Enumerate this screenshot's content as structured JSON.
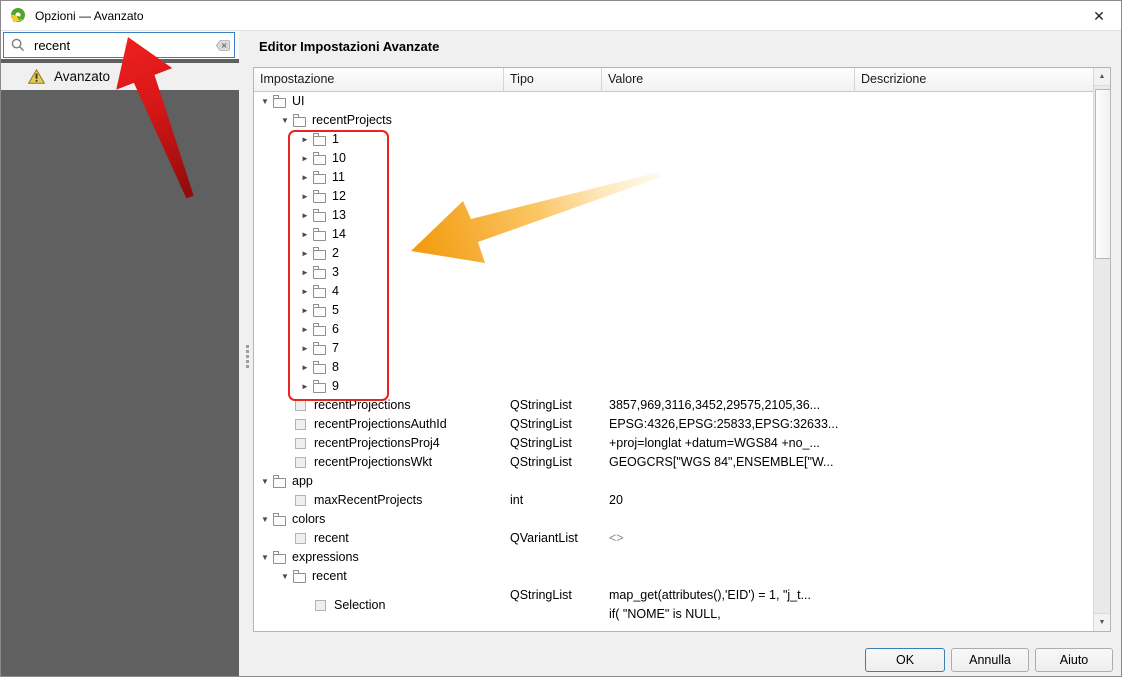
{
  "window": {
    "title": "Opzioni — Avanzato"
  },
  "icons": {
    "close": "✕",
    "expand_open": "▼",
    "expand_closed": "►",
    "scroll_up": "▲",
    "scroll_down": "▼"
  },
  "search": {
    "value": "recent"
  },
  "sidebar": {
    "items": [
      {
        "label": "Avanzato",
        "icon": "warning-icon"
      }
    ]
  },
  "panel": {
    "title": "Editor Impostazioni Avanzate"
  },
  "table": {
    "columns": [
      "Impostazione",
      "Tipo",
      "Valore",
      "Descrizione"
    ],
    "rows": [
      {
        "level": 1,
        "expand": "open",
        "icon": "folder",
        "name": "UI"
      },
      {
        "level": 2,
        "expand": "open",
        "icon": "folder",
        "name": "recentProjects"
      },
      {
        "level": 3,
        "expand": "closed",
        "icon": "folder",
        "name": "1"
      },
      {
        "level": 3,
        "expand": "closed",
        "icon": "folder",
        "name": "10"
      },
      {
        "level": 3,
        "expand": "closed",
        "icon": "folder",
        "name": "11"
      },
      {
        "level": 3,
        "expand": "closed",
        "icon": "folder",
        "name": "12"
      },
      {
        "level": 3,
        "expand": "closed",
        "icon": "folder",
        "name": "13"
      },
      {
        "level": 3,
        "expand": "closed",
        "icon": "folder",
        "name": "14"
      },
      {
        "level": 3,
        "expand": "closed",
        "icon": "folder",
        "name": "2"
      },
      {
        "level": 3,
        "expand": "closed",
        "icon": "folder",
        "name": "3"
      },
      {
        "level": 3,
        "expand": "closed",
        "icon": "folder",
        "name": "4"
      },
      {
        "level": 3,
        "expand": "closed",
        "icon": "folder",
        "name": "5"
      },
      {
        "level": 3,
        "expand": "closed",
        "icon": "folder",
        "name": "6"
      },
      {
        "level": 3,
        "expand": "closed",
        "icon": "folder",
        "name": "7"
      },
      {
        "level": 3,
        "expand": "closed",
        "icon": "folder",
        "name": "8"
      },
      {
        "level": 3,
        "expand": "closed",
        "icon": "folder",
        "name": "9"
      },
      {
        "level": 2,
        "icon": "setting",
        "name": "recentProjections",
        "type": "QStringList",
        "value": "3857,969,3116,3452,29575,2105,36..."
      },
      {
        "level": 2,
        "icon": "setting",
        "name": "recentProjectionsAuthId",
        "type": "QStringList",
        "value": "EPSG:4326,EPSG:25833,EPSG:32633..."
      },
      {
        "level": 2,
        "icon": "setting",
        "name": "recentProjectionsProj4",
        "type": "QStringList",
        "value": "+proj=longlat +datum=WGS84 +no_..."
      },
      {
        "level": 2,
        "icon": "setting",
        "name": "recentProjectionsWkt",
        "type": "QStringList",
        "value": "GEOGCRS[\"WGS 84\",ENSEMBLE[\"W..."
      },
      {
        "level": 1,
        "expand": "open",
        "icon": "folder",
        "name": "app"
      },
      {
        "level": 2,
        "icon": "setting",
        "name": "maxRecentProjects",
        "type": "int",
        "value": "20"
      },
      {
        "level": 1,
        "expand": "open",
        "icon": "folder",
        "name": "colors"
      },
      {
        "level": 2,
        "icon": "setting",
        "name": "recent",
        "type": "QVariantList",
        "value": "<>",
        "muted": true
      },
      {
        "level": 1,
        "expand": "open",
        "icon": "folder",
        "name": "expressions"
      },
      {
        "level": 2,
        "expand": "open",
        "icon": "folder",
        "name": "recent"
      },
      {
        "level": 3,
        "icon": "setting",
        "name": "Selection",
        "type": "QStringList",
        "value": "map_get(attributes(),'EID') = 1, \"j_t...",
        "value2": "if( \"NOME\" is NULL,"
      }
    ]
  },
  "buttons": {
    "ok": "OK",
    "cancel": "Annulla",
    "help": "Aiuto"
  },
  "annotations": {
    "highlight_box_target": "recentProjects numbered entries",
    "red_arrow_target": "search-input",
    "yellow_arrow_target": "highlighted list"
  },
  "colors_used": {
    "search_focus_border": "#3c80c4",
    "sidebar_bg": "#606060",
    "highlight_box": "#e8251f",
    "red_arrow_head": "#ee1c1c",
    "red_arrow_tail": "#8f0b0b",
    "yellow_arrow_head": "#f39c12",
    "yellow_arrow_tail": "#ffedc2",
    "warning_icon": "#d8bc45"
  }
}
